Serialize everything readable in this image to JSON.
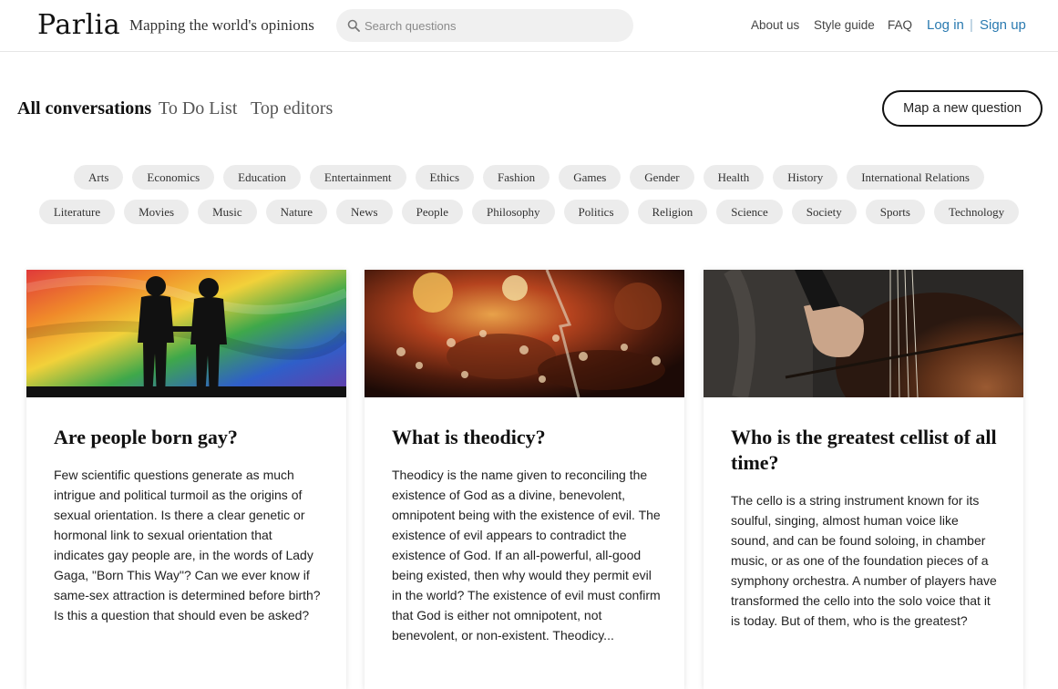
{
  "header": {
    "logo": "Parlia",
    "tagline": "Mapping the world's opinions",
    "search_placeholder": "Search questions",
    "nav": {
      "about": "About us",
      "style": "Style guide",
      "faq": "FAQ",
      "login": "Log in",
      "sep": "|",
      "signup": "Sign up"
    }
  },
  "tabs": {
    "all": "All conversations",
    "todo": "To Do List",
    "editors": "Top editors"
  },
  "map_button": "Map a new question",
  "categories_row1": [
    "Arts",
    "Economics",
    "Education",
    "Entertainment",
    "Ethics",
    "Fashion",
    "Games",
    "Gender",
    "Health",
    "History",
    "International Relations"
  ],
  "categories_row2": [
    "Literature",
    "Movies",
    "Music",
    "Nature",
    "News",
    "People",
    "Philosophy",
    "Politics",
    "Religion",
    "Science",
    "Society",
    "Sports",
    "Technology"
  ],
  "cards": [
    {
      "title": "Are people born gay?",
      "body": "Few scientific questions generate as much intrigue and political turmoil as the origins of sexual orientation. Is there a clear genetic or hormonal link to sexual orientation that indicates gay people are, in the words of Lady Gaga, \"Born This Way\"? Can we ever know if same-sex attraction is determined before birth? Is this a question that should even be asked?"
    },
    {
      "title": "What is theodicy?",
      "body": "Theodicy is the name given to reconciling the existence of God as a divine, benevolent, omnipotent being with the existence of evil. The existence of evil appears to contradict the existence of God. If an all-powerful, all-good being existed, then why would they permit evil in the world? The existence of evil must confirm that God is either not omnipotent, not benevolent, or non-existent. Theodicy..."
    },
    {
      "title": "Who is the greatest cellist of all time?",
      "body": "The cello is a string instrument known for its soulful, singing, almost human voice like sound, and can be found soloing, in chamber music, or as one of the foundation pieces of a symphony orchestra. A number of players have transformed the cello into the solo voice that it is today. But of them, who is the greatest?"
    }
  ],
  "colors": {
    "link_blue": "#2a7ab0",
    "chip_bg": "#ececec",
    "search_bg": "#f0f0f0"
  }
}
